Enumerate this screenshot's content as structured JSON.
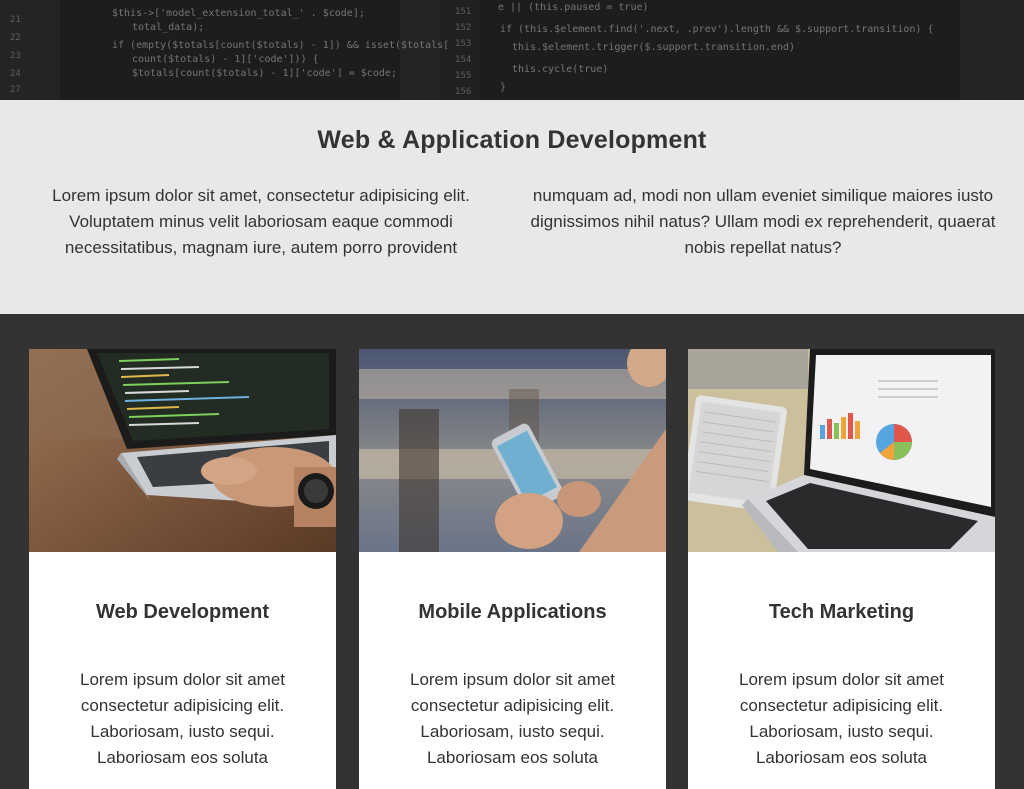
{
  "hero": {
    "code_lines_left": [
      "$this->['model_extension_total_' . $code];",
      "total_data);",
      "if (empty($totals[count($totals) - 1]) && isset($totals[",
      "count($totals) - 1]['code'])) {",
      "$totals[count($totals) - 1]['code'] = $code;"
    ],
    "code_lines_right": [
      "e || (this.paused = true)",
      "if (this.$element.find('.next, .prev').length && $.support.transition) {",
      "this.$element.trigger($.support.transition.end)",
      "this.cycle(true)",
      "}"
    ]
  },
  "intro": {
    "title": "Web & Application Development",
    "col_left": "Lorem ipsum dolor sit amet, consectetur adipisicing elit. Voluptatem minus velit laboriosam eaque commodi necessitatibus, magnam iure, autem porro provident",
    "col_right": "numquam ad, modi non ullam eveniet similique maiores iusto dignissimos nihil natus? Ullam modi ex reprehenderit, quaerat nobis repellat natus?"
  },
  "cards": [
    {
      "image_icon": "laptop-code-photo",
      "title": "Web Development",
      "text": "Lorem ipsum dolor sit amet consectetur adipisicing elit. Laboriosam, iusto sequi. Laboriosam eos soluta"
    },
    {
      "image_icon": "smartphone-photo",
      "title": "Mobile Applications",
      "text": "Lorem ipsum dolor sit amet consectetur adipisicing elit. Laboriosam, iusto sequi. Laboriosam eos soluta"
    },
    {
      "image_icon": "laptop-charts-photo",
      "title": "Tech Marketing",
      "text": "Lorem ipsum dolor sit amet consectetur adipisicing elit. Laboriosam, iusto sequi. Laboriosam eos soluta"
    }
  ]
}
